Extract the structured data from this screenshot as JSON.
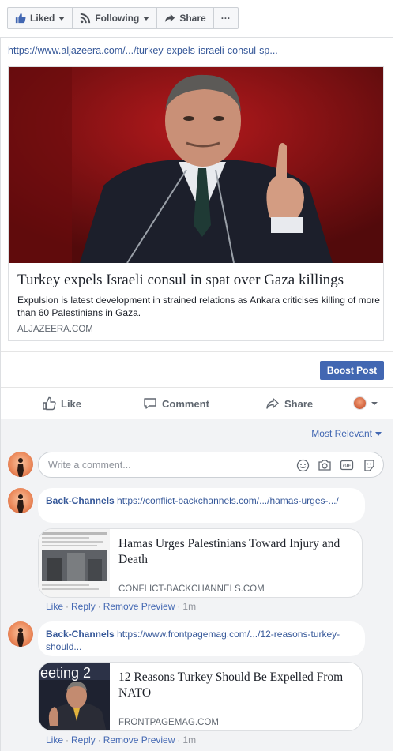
{
  "topbar": {
    "liked_label": "Liked",
    "following_label": "Following",
    "share_label": "Share",
    "more_label": "···"
  },
  "post": {
    "link_url": "https://www.aljazeera.com/.../turkey-expels-israeli-consul-sp...",
    "card": {
      "title": "Turkey expels Israeli consul in spat over Gaza killings",
      "description": "Expulsion is latest development in strained relations as Ankara criticises killing of more than 60 Palestinians in Gaza.",
      "domain": "ALJAZEERA.COM"
    },
    "boost_label": "Boost Post",
    "actions": {
      "like": "Like",
      "comment": "Comment",
      "share": "Share"
    }
  },
  "comments": {
    "sort_label": "Most Relevant",
    "write_placeholder": "Write a comment...",
    "items": [
      {
        "author": "Back-Channels",
        "text": " https://conflict-backchannels.com/.../hamas-urges-.../",
        "preview_title": "Hamas Urges Palestinians Toward Injury and Death",
        "preview_domain": "CONFLICT-BACKCHANNELS.COM",
        "like": "Like",
        "reply": "Reply",
        "remove_preview": "Remove Preview",
        "time": "1m"
      },
      {
        "author": "Back-Channels",
        "text": " https://www.frontpagemag.com/.../12-reasons-turkey-should...",
        "preview_title": "12 Reasons Turkey Should Be Expelled From NATO",
        "preview_domain": "FRONTPAGEMAG.COM",
        "like": "Like",
        "reply": "Reply",
        "remove_preview": "Remove Preview",
        "time": "1m"
      }
    ]
  },
  "colors": {
    "link_blue": "#365899",
    "accent_blue": "#4267b2",
    "muted_gray": "#606770",
    "comment_bg": "#f2f3f5"
  }
}
